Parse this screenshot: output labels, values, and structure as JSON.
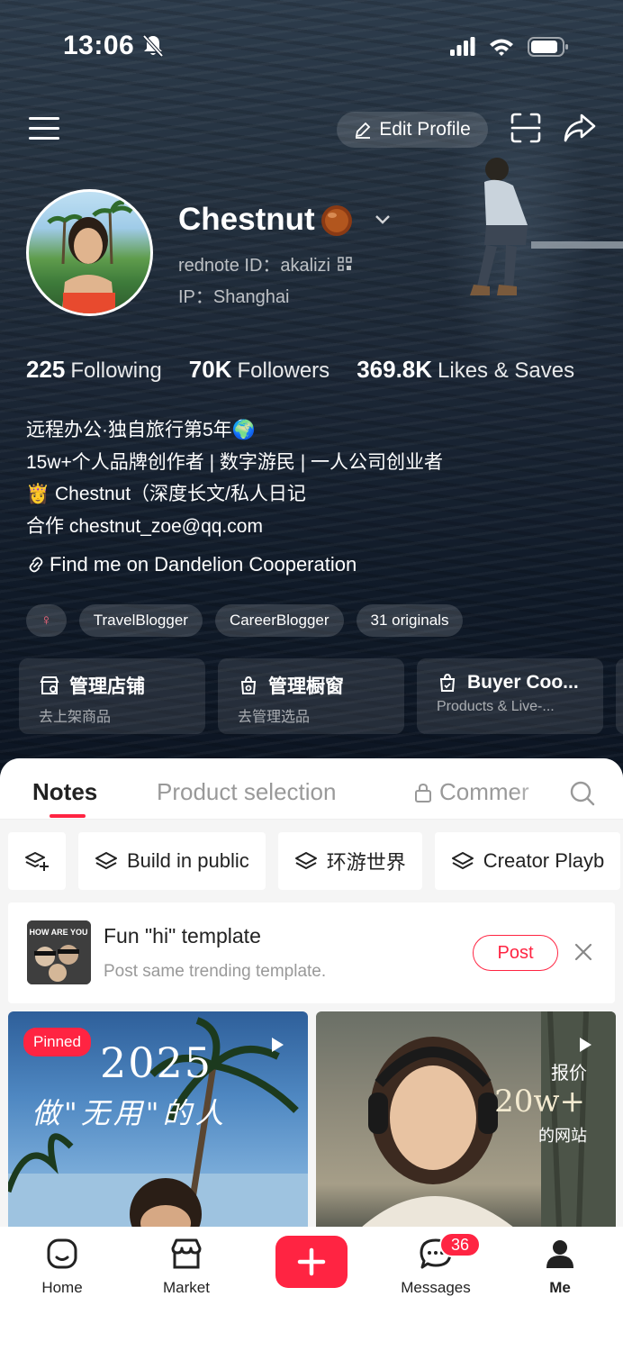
{
  "status_bar": {
    "time": "13:06"
  },
  "header": {
    "edit_profile_label": "Edit Profile"
  },
  "profile": {
    "name": "Chestnut",
    "rednote_id": "rednote ID：akalizi",
    "ip": "IP：Shanghai"
  },
  "stats": [
    {
      "value": "225",
      "label": "Following"
    },
    {
      "value": "70K",
      "label": "Followers"
    },
    {
      "value": "369.8K",
      "label": "Likes & Saves"
    }
  ],
  "bio": [
    "远程办公·独自旅行第5年🌍",
    "15w+个人品牌创作者 | 数字游民 | 一人公司创业者",
    "👸 Chestnut（深度长文/私人日记",
    "合作 chestnut_zoe@qq.com"
  ],
  "link_text": "Find me on Dandelion Cooperation",
  "tags": [
    "♀",
    "TravelBlogger",
    "CareerBlogger",
    "31 originals"
  ],
  "cards": [
    {
      "title": "管理店铺",
      "subtitle": "去上架商品"
    },
    {
      "title": "管理橱窗",
      "subtitle": "去管理选品"
    },
    {
      "title": "Buyer Coo...",
      "subtitle": "Products & Live-..."
    }
  ],
  "tabs": [
    "Notes",
    "Product selection",
    "Commer"
  ],
  "chips": [
    "Build in public",
    "环游世界",
    "Creator Playb"
  ],
  "template_prompt": {
    "title": "Fun \"hi\" template",
    "subtitle": "Post same trending template.",
    "button": "Post",
    "thumb_text": "HOW ARE YOU"
  },
  "posts": [
    {
      "badge": "Pinned",
      "year": "2025",
      "title": "做\"无用\"的人"
    },
    {
      "line1": "报价",
      "line2": "20w+",
      "line3": "的网站"
    }
  ],
  "bottom_nav": {
    "items": [
      "Home",
      "Market",
      "Messages",
      "Me"
    ],
    "messages_badge": "36"
  },
  "colors": {
    "accent": "#ff2442",
    "hero_bg": "#1b2635"
  },
  "icons": [
    "bell-off-icon",
    "signal-icon",
    "wifi-icon",
    "battery-icon",
    "menu-icon",
    "pencil-icon",
    "scan-icon",
    "share-icon",
    "chevron-down-icon",
    "qr-code-icon",
    "link-icon",
    "store-icon",
    "bag-icon",
    "lock-icon",
    "search-icon",
    "add-collection-icon",
    "layers-icon",
    "close-icon",
    "play-icon",
    "home-icon",
    "market-icon",
    "plus-icon",
    "chat-icon",
    "user-icon"
  ]
}
